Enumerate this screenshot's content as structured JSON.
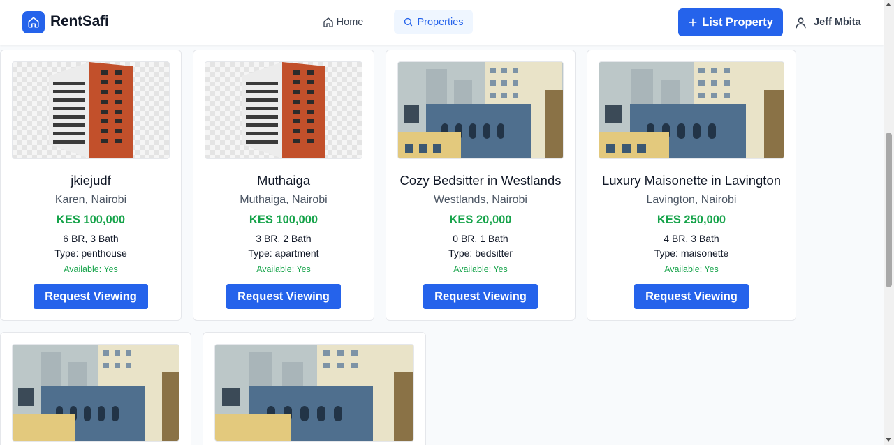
{
  "header": {
    "brand": "RentSafi",
    "nav": {
      "home": "Home",
      "properties": "Properties"
    },
    "list_property": "List Property",
    "user_name": "Jeff Mbita"
  },
  "colors": {
    "primary": "#2563eb",
    "price_green": "#16a34a",
    "active_nav_bg": "#eff6ff"
  },
  "properties": [
    {
      "title": "jkiejudf",
      "location": "Karen, Nairobi",
      "price": "KES 100,000",
      "rooms": "6 BR, 3 Bath",
      "type": "Type: penthouse",
      "available": "Available: Yes",
      "button": "Request Viewing",
      "image": "tower-building"
    },
    {
      "title": "Muthaiga",
      "location": "Muthaiga, Nairobi",
      "price": "KES 100,000",
      "rooms": "3 BR, 2 Bath",
      "type": "Type: apartment",
      "available": "Available: Yes",
      "button": "Request Viewing",
      "image": "tower-building"
    },
    {
      "title": "Cozy Bedsitter in Westlands",
      "location": "Westlands, Nairobi",
      "price": "KES 20,000",
      "rooms": "0 BR, 1 Bath",
      "type": "Type: bedsitter",
      "available": "Available: Yes",
      "button": "Request Viewing",
      "image": "city-illustration"
    },
    {
      "title": "Luxury Maisonette in Lavington",
      "location": "Lavington, Nairobi",
      "price": "KES 250,000",
      "rooms": "4 BR, 3 Bath",
      "type": "Type: maisonette",
      "available": "Available: Yes",
      "button": "Request Viewing",
      "image": "city-illustration"
    },
    {
      "image": "city-illustration"
    },
    {
      "image": "city-illustration"
    }
  ]
}
